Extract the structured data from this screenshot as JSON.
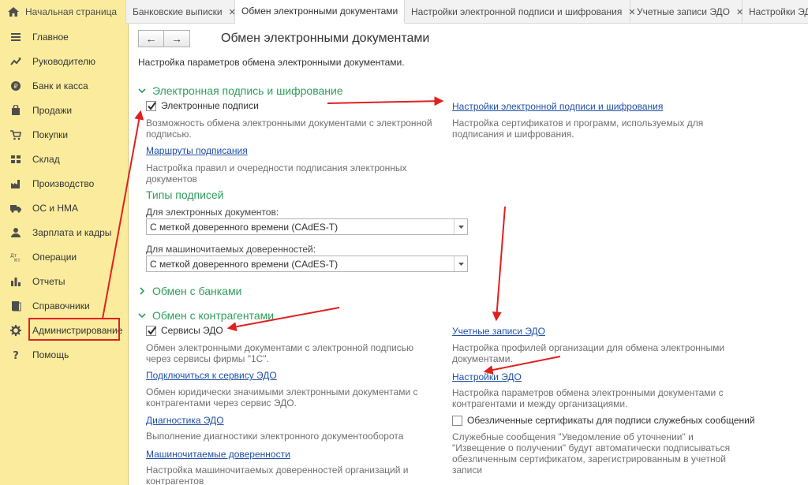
{
  "tabs": [
    {
      "label": "Начальная страница",
      "home": true,
      "close": false,
      "active": false
    },
    {
      "label": "Банковские выписки",
      "close": true,
      "active": false
    },
    {
      "label": "Обмен электронными документами",
      "close": false,
      "active": true
    },
    {
      "label": "Настройки электронной подписи и шифрования",
      "close": true,
      "active": false
    },
    {
      "label": "Учетные записи ЭДО",
      "close": true,
      "active": false
    },
    {
      "label": "Настройки ЭДО",
      "close": false,
      "active": false
    }
  ],
  "tab_close_glyph": "✕",
  "sidebar": {
    "items": [
      {
        "label": "Главное",
        "icon": "menu-icon"
      },
      {
        "label": "Руководителю",
        "icon": "trend-icon"
      },
      {
        "label": "Банк и касса",
        "icon": "coin-icon"
      },
      {
        "label": "Продажи",
        "icon": "bag-icon"
      },
      {
        "label": "Покупки",
        "icon": "cart-icon"
      },
      {
        "label": "Склад",
        "icon": "warehouse-icon"
      },
      {
        "label": "Производство",
        "icon": "factory-icon"
      },
      {
        "label": "ОС и НМА",
        "icon": "truck-icon"
      },
      {
        "label": "Зарплата и кадры",
        "icon": "person-icon"
      },
      {
        "label": "Операции",
        "icon": "dt-kt-icon"
      },
      {
        "label": "Отчеты",
        "icon": "bar-chart-icon"
      },
      {
        "label": "Справочники",
        "icon": "books-icon"
      },
      {
        "label": "Администрирование",
        "icon": "gear-icon"
      },
      {
        "label": "Помощь",
        "icon": "question-icon"
      }
    ]
  },
  "nav": {
    "back": "←",
    "forward": "→"
  },
  "page": {
    "title": "Обмен электронными документами",
    "subtitle": "Настройка параметров обмена электронными документами."
  },
  "sig_section": {
    "title": "Электронная подпись и шифрование",
    "checkbox_label": "Электронные подписи",
    "checkbox_desc_1": "Возможность обмена электронными документами с электронной",
    "checkbox_desc_2": "подписью.",
    "routes_link": "Маршруты подписания",
    "routes_desc_1": "Настройка правил и очередности подписания электронных",
    "routes_desc_2": "документов",
    "settings_link": "Настройки электронной подписи и шифрования",
    "settings_desc_1": "Настройка сертификатов и программ, используемых для",
    "settings_desc_2": "подписания и шифрования.",
    "types_heading": "Типы подписей",
    "edoc_label": "Для электронных документов:",
    "edoc_value": "С меткой доверенного времени (CAdES-T)",
    "poa_label": "Для машиночитаемых доверенностей:",
    "poa_value": "С меткой доверенного времени (CAdES-T)"
  },
  "banks_section": {
    "title": "Обмен с банками"
  },
  "partners_section": {
    "title": "Обмен с контрагентами",
    "edo_checkbox_label": "Сервисы ЭДО",
    "edo_desc_1": "Обмен электронными документами с электронной подписью",
    "edo_desc_2": "через сервисы фирмы \"1С\".",
    "connect_link": "Подключиться к сервису ЭДО",
    "connect_desc_1": "Обмен юридически значимыми электронными документами с",
    "connect_desc_2": "контрагентами через сервис ЭДО.",
    "diag_link": "Диагностика ЭДО",
    "diag_desc": "Выполнение диагностики электронного документооборота",
    "poa_link": "Машиночитаемые доверенности",
    "poa_desc_1": "Настройка машиночитаемых доверенностей организаций и",
    "poa_desc_2": "контрагентов",
    "accounts_link": "Учетные записи ЭДО",
    "accounts_desc_1": "Настройка профилей организации для обмена электронными",
    "accounts_desc_2": "документами.",
    "edo_settings_link": "Настройки ЭДО",
    "edo_settings_desc_1": "Настройка параметров обмена электронными документами с",
    "edo_settings_desc_2": "контрагентами и между организациями.",
    "anon_cert_label": "Обезличенные сертификаты для подписи служебных сообщений",
    "anon_desc_1": "Служебные сообщения \"Уведомление об уточнении\" и",
    "anon_desc_2": "\"Извещение о получении\" будут автоматически подписываться",
    "anon_desc_3": "обезличенным сертификатом, зарегистрированным в учетной",
    "anon_desc_4": "записи"
  },
  "colors": {
    "sidebar_bg": "#fbec9d",
    "section_green": "#2e9e5b",
    "link_blue": "#1f4fa6",
    "annotation_red": "#e02020"
  }
}
